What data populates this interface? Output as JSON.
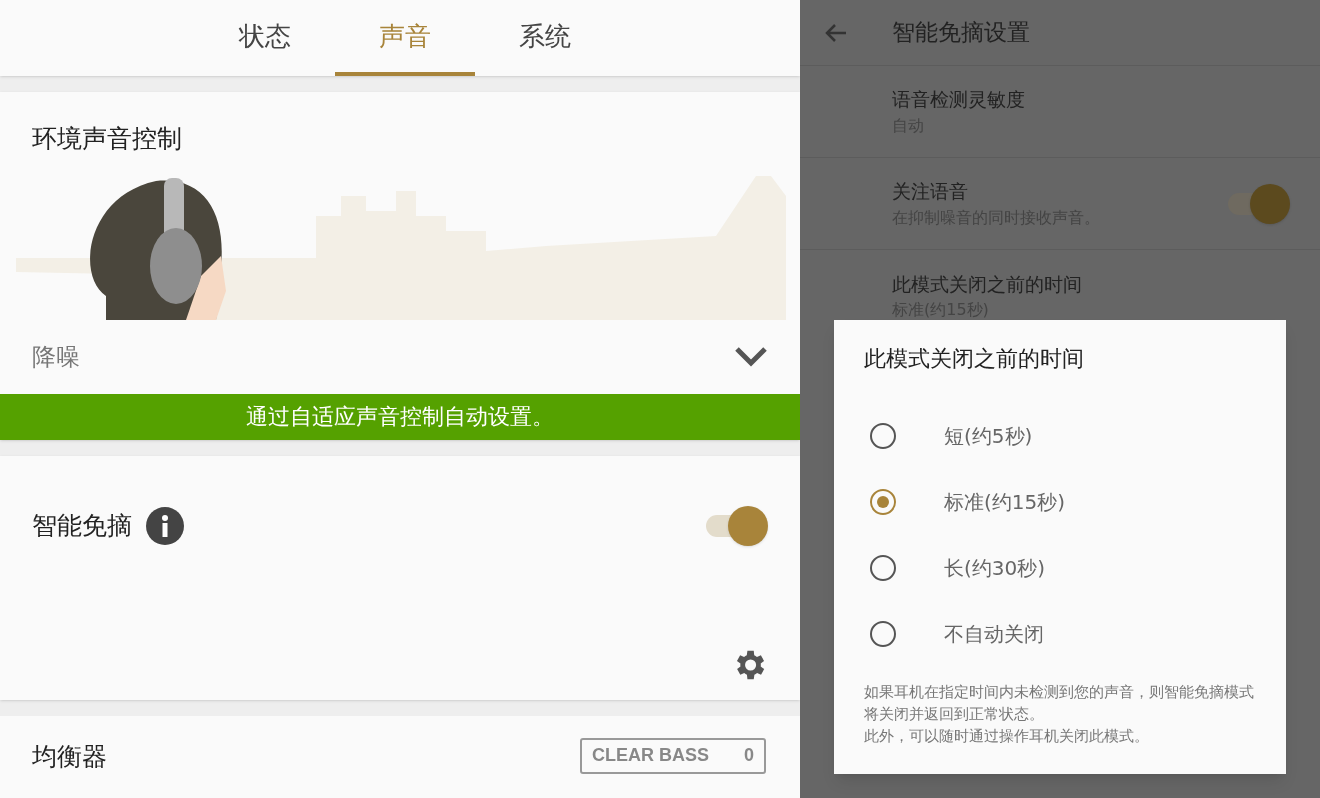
{
  "tabs": [
    {
      "label": "状态",
      "selected": false
    },
    {
      "label": "声音",
      "selected": true
    },
    {
      "label": "系统",
      "selected": false
    }
  ],
  "ambient": {
    "title": "环境声音控制",
    "mode": "降噪",
    "banner": "通过自适应声音控制自动设置。"
  },
  "smart": {
    "title": "智能免摘",
    "on": true
  },
  "equalizer": {
    "title": "均衡器",
    "badge_label": "CLEAR BASS",
    "badge_value": "0"
  },
  "settings": {
    "title": "智能免摘设置",
    "rows": [
      {
        "kind": "text",
        "title": "语音检测灵敏度",
        "subtitle": "自动"
      },
      {
        "kind": "switch",
        "title": "关注语音",
        "subtitle": "在抑制噪音的同时接收声音。",
        "on": true
      },
      {
        "kind": "text",
        "title": "此模式关闭之前的时间",
        "subtitle": "标准(约15秒)"
      }
    ]
  },
  "dialog": {
    "title": "此模式关闭之前的时间",
    "options": [
      {
        "label": "短(约5秒)",
        "selected": false
      },
      {
        "label": "标准(约15秒)",
        "selected": true
      },
      {
        "label": "长(约30秒)",
        "selected": false
      },
      {
        "label": "不自动关闭",
        "selected": false
      }
    ],
    "notes": [
      "如果耳机在指定时间内未检测到您的声音，则智能免摘模式将关闭并返回到正常状态。",
      "此外，可以随时通过操作耳机关闭此模式。"
    ]
  }
}
